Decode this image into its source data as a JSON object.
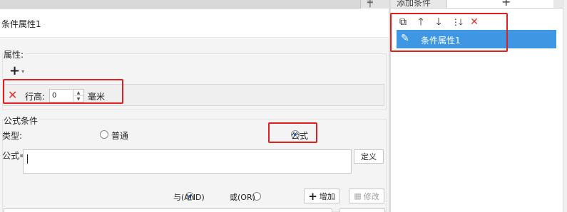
{
  "window": {
    "grid_icon": "grid-plus-icon"
  },
  "left": {
    "title": "条件属性1",
    "attributes": {
      "section_label": "属性:",
      "add_icon": "plus-icon",
      "row": {
        "remove_icon": "close-icon",
        "label": "行高:",
        "value": "0",
        "unit": "毫米"
      }
    },
    "formula_condition": {
      "section_label": "公式条件",
      "type_label": "类型:",
      "options": [
        {
          "label": "普通",
          "selected": false
        },
        {
          "label": "公式",
          "selected": true
        }
      ],
      "formula_label": "公式=",
      "formula_value": "",
      "define_button": "定义",
      "logic_options": [
        {
          "label": "与(AND)",
          "selected": true
        },
        {
          "label": "或(OR)",
          "selected": false
        }
      ],
      "add_button": "增加",
      "modify_button": "修改"
    }
  },
  "right": {
    "header_title": "添加条件",
    "header_add_icon": "plus-icon",
    "toolbar": [
      {
        "icon": "copy-icon"
      },
      {
        "icon": "arrow-up-icon"
      },
      {
        "icon": "arrow-down-icon"
      },
      {
        "icon": "sort-down-icon"
      },
      {
        "icon": "delete-icon"
      }
    ],
    "items": [
      {
        "label": "条件属性1",
        "icon": "edit-pen-icon",
        "selected": true
      }
    ]
  },
  "colors": {
    "highlight": "#e02020",
    "selection": "#3f97e4",
    "delete_red": "#e03030"
  }
}
